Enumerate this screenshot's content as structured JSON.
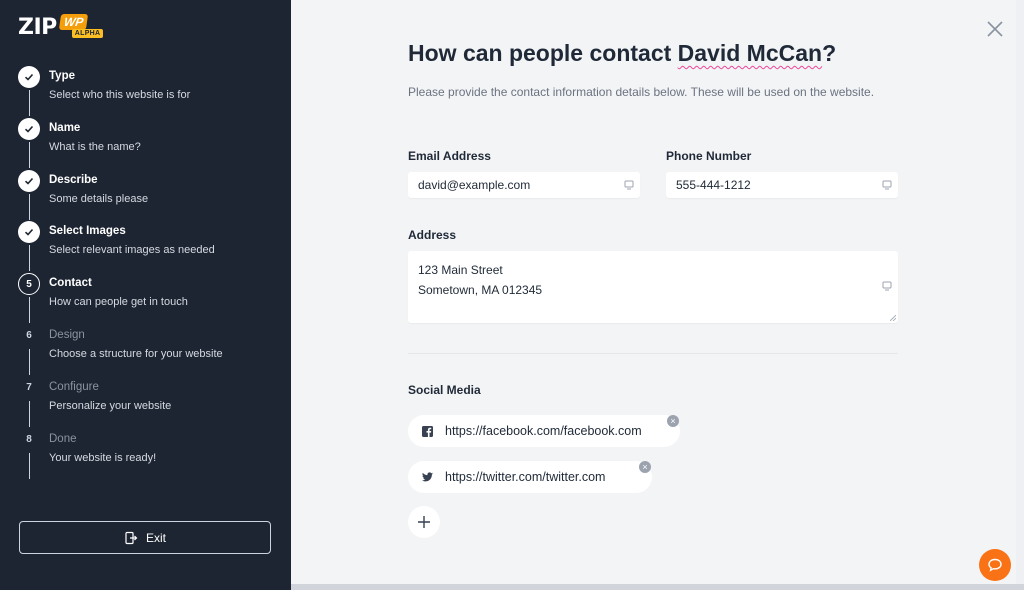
{
  "brand": {
    "logo_text": "ZIP",
    "badge_text": "WP",
    "badge_sub": "ALPHA"
  },
  "steps": [
    {
      "num": "",
      "title": "Type",
      "subtitle": "Select who this website is for",
      "state": "done"
    },
    {
      "num": "",
      "title": "Name",
      "subtitle": "What is the name?",
      "state": "done"
    },
    {
      "num": "",
      "title": "Describe",
      "subtitle": "Some details please",
      "state": "done"
    },
    {
      "num": "",
      "title": "Select Images",
      "subtitle": "Select relevant images as needed",
      "state": "done"
    },
    {
      "num": "5",
      "title": "Contact",
      "subtitle": "How can people get in touch",
      "state": "active"
    },
    {
      "num": "6",
      "title": "Design",
      "subtitle": "Choose a structure for your website",
      "state": "todo"
    },
    {
      "num": "7",
      "title": "Configure",
      "subtitle": "Personalize your website",
      "state": "todo"
    },
    {
      "num": "8",
      "title": "Done",
      "subtitle": "Your website is ready!",
      "state": "todo"
    }
  ],
  "exit_label": "Exit",
  "main": {
    "heading_prefix": "How can people contact ",
    "heading_name": "David McCan",
    "heading_suffix": "?",
    "description": "Please provide the contact information details below. These will be used on the website.",
    "email_label": "Email Address",
    "email_value": "david@example.com",
    "phone_label": "Phone Number",
    "phone_value": "555-444-1212",
    "address_label": "Address",
    "address_line1": "123 Main Street",
    "address_line2": "Sometown, MA 012345",
    "social_label": "Social Media",
    "social": [
      {
        "icon": "facebook-icon",
        "url": "https://facebook.com/facebook.com"
      },
      {
        "icon": "twitter-icon",
        "url": "https://twitter.com/twitter.com"
      }
    ]
  },
  "colors": {
    "sidebar": "#1e2532",
    "accent": "#f97316",
    "underline": "#ec4899"
  }
}
